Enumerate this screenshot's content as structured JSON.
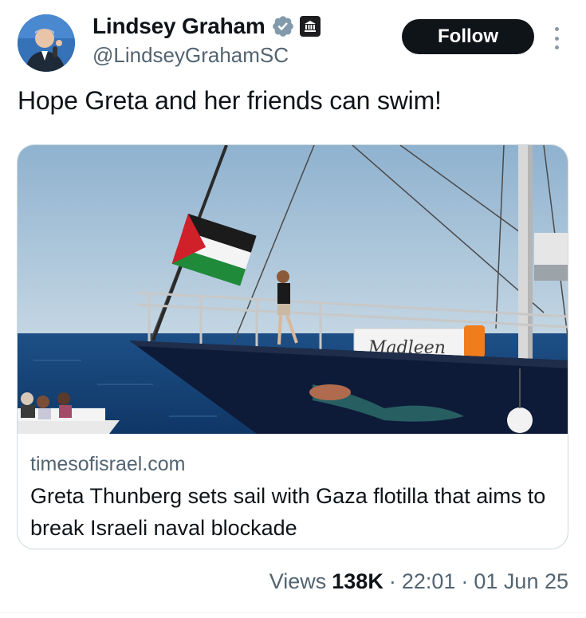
{
  "author": {
    "name": "Lindsey Graham",
    "handle": "@LindseyGrahamSC",
    "verified_color": "#829aab",
    "avatar_icon": "profile-photo"
  },
  "actions": {
    "follow_label": "Follow",
    "more_icon": "more-vertical-icon"
  },
  "tweet": {
    "text": "Hope Greta and her friends can swim!"
  },
  "link_card": {
    "domain": "timesofisrael.com",
    "title": "Greta Thunberg sets sail with Gaza flotilla that aims to break Israeli naval blockade",
    "image_label": "Madleen"
  },
  "meta": {
    "views_label": "Views",
    "views_count": "138K",
    "separator": "·",
    "time": "22:01",
    "date": "01 Jun 25"
  }
}
